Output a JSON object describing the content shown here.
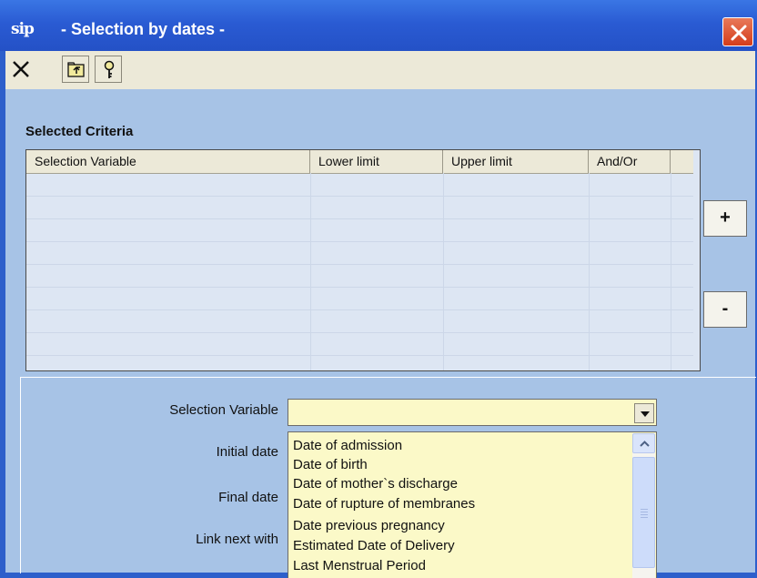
{
  "window": {
    "title": "- Selection by dates -",
    "logo_text": "sip",
    "titlebar_color": "#2a5bd3",
    "body_color": "#a7c3e6"
  },
  "toolbar": {
    "buttons": [
      {
        "name": "close",
        "icon": "x-icon"
      },
      {
        "name": "folder-up",
        "icon": "folder-up-icon"
      },
      {
        "name": "help",
        "icon": "help-key-icon"
      }
    ]
  },
  "criteria": {
    "label": "Selected Criteria",
    "columns": [
      "Selection Variable",
      "Lower limit",
      "Upper limit",
      "And/Or"
    ],
    "rows": [],
    "add_label": "+",
    "remove_label": "-"
  },
  "form": {
    "selection_variable_label": "Selection Variable",
    "selection_variable_value": "",
    "initial_date_label": "Initial date",
    "final_date_label": "Final date",
    "link_next_label": "Link next with",
    "field_color": "#fbf9c8"
  },
  "dropdown": {
    "options": [
      "Date of admission",
      "Date of birth",
      "Date of mother`s discharge",
      "Date of rupture of membranes",
      "Date previous pregnancy",
      "Estimated Date of Delivery",
      "Last Menstrual Period"
    ]
  }
}
